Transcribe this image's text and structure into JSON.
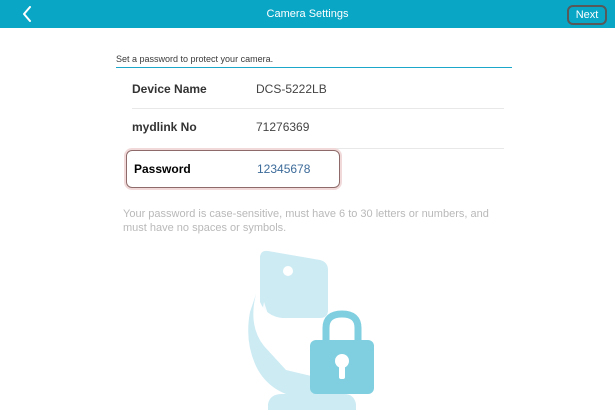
{
  "header": {
    "title": "Camera Settings",
    "next_label": "Next",
    "background": "#0aa6c6"
  },
  "intro": {
    "text": "Set a password to protect your camera."
  },
  "fields": {
    "device_name": {
      "label": "Device Name",
      "value": "DCS-5222LB"
    },
    "mydlink_no": {
      "label": "mydlink No",
      "value": "71276369"
    },
    "password": {
      "label": "Password",
      "value": "12345678"
    }
  },
  "hint": "Your password is case-sensitive, must have 6 to 30 letters or numbers, and must have no spaces or symbols.",
  "icons": {
    "back": "chevron-left-icon",
    "illustration": "camera-lock-icon"
  },
  "colors": {
    "accent": "#0aa6c6",
    "password_value": "#3c6b9a",
    "hint_text": "#b9b9b9",
    "illustration_light": "#cdebf3",
    "illustration_dark": "#7fcfe0"
  }
}
